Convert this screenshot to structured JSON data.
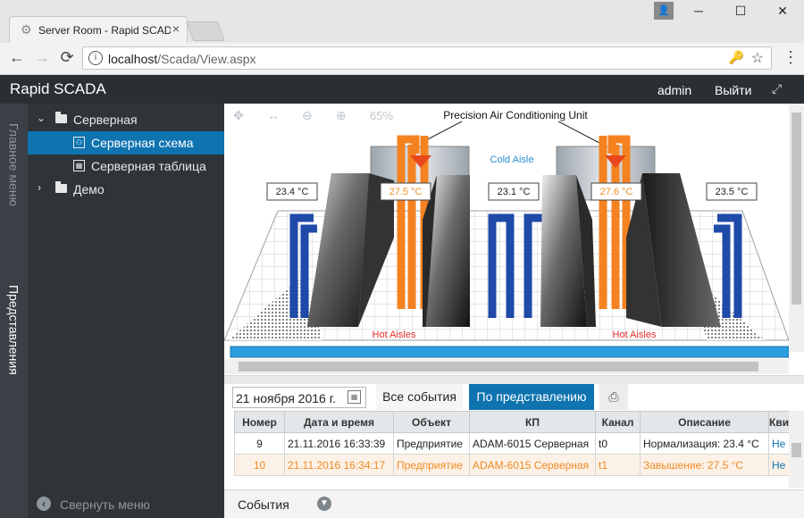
{
  "browser": {
    "tab_title": "Server Room - Rapid SCADA",
    "tab_close": "×",
    "profile_icon": "person-icon",
    "window_controls": {
      "minimize": "─",
      "maximize": "☐",
      "close": "✕"
    },
    "url_host": "localhost",
    "url_path": "/Scada/View.aspx",
    "nav": {
      "back": "←",
      "forward": "→",
      "reload": "⟳"
    },
    "menu": "⋮"
  },
  "app": {
    "title": "Rapid SCADA",
    "user": "admin",
    "logout": "Выйти",
    "accent": "#0f73b0"
  },
  "vertical_tabs": {
    "main_menu": "Главное меню",
    "views": "Представления"
  },
  "tree": [
    {
      "label": "Серверная",
      "expanded": true
    },
    {
      "label": "Серверная схема",
      "selected": true
    },
    {
      "label": "Серверная таблица"
    },
    {
      "label": "Демо",
      "expanded": false
    }
  ],
  "collapse_menu": "Свернуть меню",
  "scheme": {
    "zoom": "65%",
    "title": "Precision Air Conditioning Unit",
    "cold_aisle": "Cold Aisle",
    "hot_aisle_left": "Hot Aisles",
    "hot_aisle_right": "Hot Aisles",
    "temps": [
      "23.4 °C",
      "27.5 °C",
      "23.1 °C",
      "27.6 °C",
      "23.5 °C"
    ],
    "colors": {
      "hot": "#f58220",
      "cold": "#1f4aa8",
      "alarm_text": "#f08b25"
    }
  },
  "events": {
    "date": "21 ноября 2016 г.",
    "all_events": "Все события",
    "by_view": "По представлению",
    "columns": [
      "Номер",
      "Дата и время",
      "Объект",
      "КП",
      "Канал",
      "Описание",
      "Кви"
    ],
    "rows": [
      {
        "num": "9",
        "datetime": "21.11.2016 16:33:39",
        "object": "Предприятие",
        "device": "ADAM-6015 Серверная",
        "channel": "t0",
        "description": "Нормализация: 23.4 °C",
        "ack": "Не",
        "alarm": false
      },
      {
        "num": "10",
        "datetime": "21.11.2016 16:34:17",
        "object": "Предприятие",
        "device": "ADAM-6015 Серверная",
        "channel": "t1",
        "description": "Завышение: 27.5 °C",
        "ack": "Не",
        "alarm": true
      }
    ]
  },
  "footer": {
    "label": "События"
  }
}
